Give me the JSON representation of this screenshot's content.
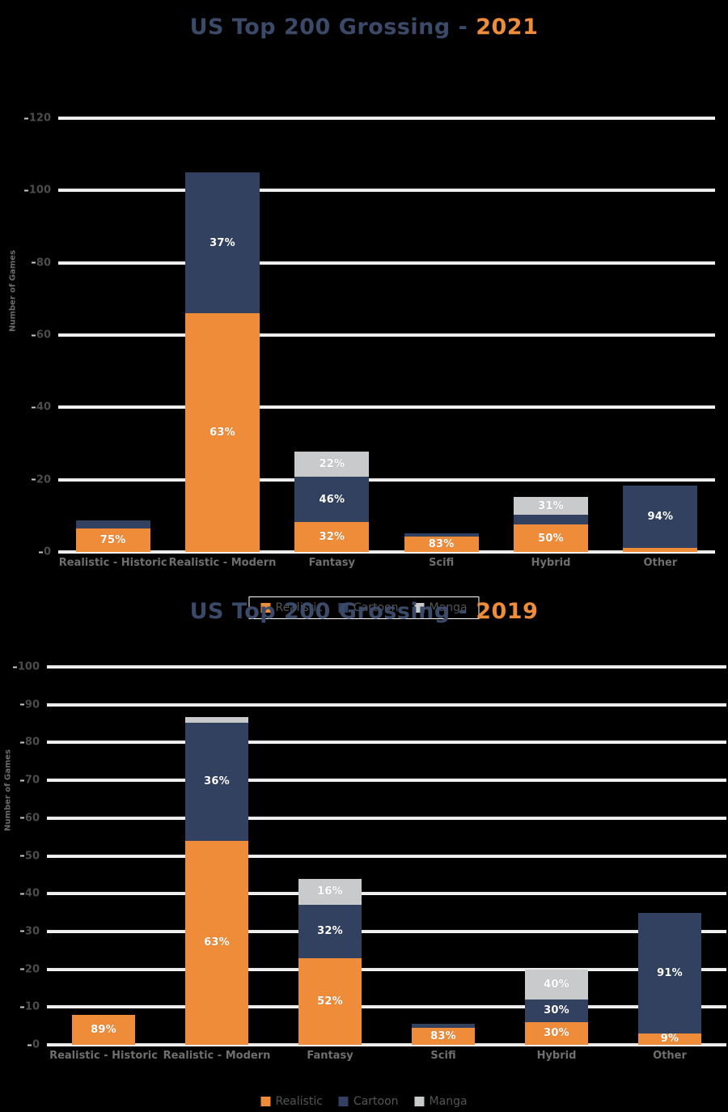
{
  "charts": [
    {
      "title_main": "US Top 200 Grossing - ",
      "title_year": "2021",
      "ylabel": "Number of Games",
      "legend": [
        {
          "label": "Realistic",
          "color": "#ef8c3a"
        },
        {
          "label": "Cartoon",
          "color": "#32415f"
        },
        {
          "label": "Manga",
          "color": "#c9cacc"
        }
      ],
      "chart_data": {
        "type": "bar",
        "subtype": "stacked",
        "title": "US Top 200 Grossing - 2021",
        "xlabel": "",
        "ylabel": "Number of Games",
        "ylim": [
          0,
          120
        ],
        "yticks": [
          0,
          20,
          40,
          60,
          80,
          100,
          120
        ],
        "grid": true,
        "legend_position": "bottom",
        "categories": [
          "Realistic - Historic",
          "Realistic - Modern",
          "Fantasy",
          "Scifi",
          "Hybrid",
          "Other"
        ],
        "series": [
          {
            "name": "Realistic",
            "color": "#ef8c3a",
            "values": [
              6.5,
              66,
              8.3,
              4.2,
              7.6,
              1.2
            ]
          },
          {
            "name": "Cartoon",
            "color": "#32415f",
            "values": [
              2.2,
              39,
              12.5,
              0.9,
              2.7,
              17.1
            ]
          },
          {
            "name": "Manga",
            "color": "#c9cacc",
            "values": [
              0,
              0,
              6.9,
              0,
              4.9,
              0
            ]
          }
        ],
        "data_labels": [
          {
            "category": "Realistic - Historic",
            "series": "Realistic",
            "text": "75%"
          },
          {
            "category": "Realistic - Modern",
            "series": "Realistic",
            "text": "63%"
          },
          {
            "category": "Realistic - Modern",
            "series": "Cartoon",
            "text": "37%"
          },
          {
            "category": "Fantasy",
            "series": "Realistic",
            "text": "32%"
          },
          {
            "category": "Fantasy",
            "series": "Cartoon",
            "text": "46%"
          },
          {
            "category": "Fantasy",
            "series": "Manga",
            "text": "22%"
          },
          {
            "category": "Scifi",
            "series": "Realistic",
            "text": "83%"
          },
          {
            "category": "Hybrid",
            "series": "Realistic",
            "text": "50%"
          },
          {
            "category": "Hybrid",
            "series": "Manga",
            "text": "31%"
          },
          {
            "category": "Other",
            "series": "Cartoon",
            "text": "94%"
          }
        ]
      }
    },
    {
      "title_main": "US Top 200 Grossing - ",
      "title_year": "2019",
      "ylabel": "Number of Games",
      "legend": [
        {
          "label": "Realistic",
          "color": "#ef8c3a"
        },
        {
          "label": "Cartoon",
          "color": "#32415f"
        },
        {
          "label": "Manga",
          "color": "#c9cacc"
        }
      ],
      "chart_data": {
        "type": "bar",
        "subtype": "stacked",
        "title": "US Top 200 Grossing - 2019",
        "xlabel": "",
        "ylabel": "Number of Games",
        "ylim": [
          0,
          100
        ],
        "yticks": [
          0,
          10,
          20,
          30,
          40,
          50,
          60,
          70,
          80,
          90,
          100
        ],
        "grid": true,
        "legend_position": "bottom",
        "categories": [
          "Realistic - Historic",
          "Realistic - Modern",
          "Fantasy",
          "Scifi",
          "Hybrid",
          "Other"
        ],
        "series": [
          {
            "name": "Realistic",
            "color": "#ef8c3a",
            "values": [
              8,
              54,
              23,
              4.6,
              6,
              3.1
            ]
          },
          {
            "name": "Cartoon",
            "color": "#32415f",
            "values": [
              0,
              31.3,
              14,
              0.9,
              6,
              31.9
            ]
          },
          {
            "name": "Manga",
            "color": "#c9cacc",
            "values": [
              0,
              1.5,
              7,
              0,
              8,
              0
            ]
          }
        ],
        "data_labels": [
          {
            "category": "Realistic - Historic",
            "series": "Realistic",
            "text": "89%"
          },
          {
            "category": "Realistic - Modern",
            "series": "Realistic",
            "text": "63%"
          },
          {
            "category": "Realistic - Modern",
            "series": "Cartoon",
            "text": "36%"
          },
          {
            "category": "Fantasy",
            "series": "Realistic",
            "text": "52%"
          },
          {
            "category": "Fantasy",
            "series": "Cartoon",
            "text": "32%"
          },
          {
            "category": "Fantasy",
            "series": "Manga",
            "text": "16%"
          },
          {
            "category": "Scifi",
            "series": "Realistic",
            "text": "83%"
          },
          {
            "category": "Hybrid",
            "series": "Realistic",
            "text": "30%"
          },
          {
            "category": "Hybrid",
            "series": "Cartoon",
            "text": "30%"
          },
          {
            "category": "Hybrid",
            "series": "Manga",
            "text": "40%"
          },
          {
            "category": "Other",
            "series": "Realistic",
            "text": "9%"
          },
          {
            "category": "Other",
            "series": "Cartoon",
            "text": "91%"
          }
        ]
      }
    }
  ]
}
